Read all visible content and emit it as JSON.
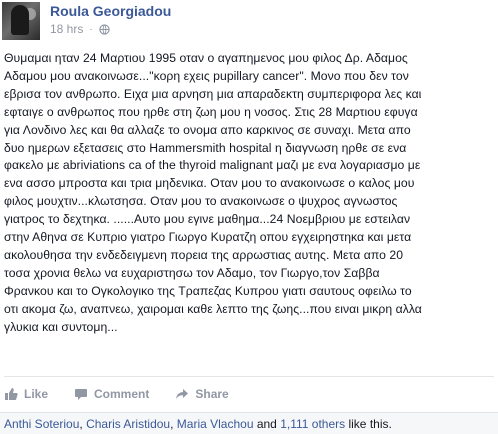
{
  "post": {
    "author": "Roula Georgiadou",
    "timestamp": "18 hrs",
    "separator": "·",
    "privacy_icon": "globe-icon",
    "body": "Θυμαμαι ηταν 24 Μαρτιου 1995 οταν ο αγαπημενος μου φιλος Δρ. Αδαμος\nΑδαμου μου ανακοινωσε...\"κορη εχεις pupillary cancer\". Μονο που δεν τον\nεβρισα τον ανθρωπο. Ειχα μια αρνηση μια απαραδεκτη συμπεριφορα λες και\nεφταιγε ο ανθρωπος που ηρθε στη ζωη μου η νοσος. Στις 28 Μαρτιου εφυγα\nγια Λονδινο λες και θα αλλαζε το ονομα απο καρκινος σε συναχι. Μετα απο\nδυο ημερων εξετασεις στο Hammersmith hospital η διαγνωση ηρθε σε ενα\nφακελο με abriviations ca of the thyroid malignant μαζι με ενα λογαριασμο με\nενα ασσο μπροστα και τρια μηδενικα. Οταν μου το ανακοινωσε ο καλος μου\nφιλος μουχτιν...κλωτσησα. Οταν μου το ανακοινωσε ο ψυχρος αγνωστος\nγιατρος το δεχτηκα. ......Αυτο μου εγινε μαθημα...24 Νοεμβριου με εστειλαν\nστην Αθηνα σε Κυπριο γιατρο Γιωργο Κυρατζη οπου εγχειρηστηκα και μετα\nακολουθησα την ενδεδειγμενη πορεια της αρρωστιας αυτης. Μετα απο 20\nτοσα χρονια θελω να ευχαριστησω τον Αδαμο, τον Γιωργο,τον Σαββα\nΦρανκου και το Ογκολογικο της Τραπεζας Κυπρου γιατι σαυτους οφειλω το\nοτι ακομα ζω, αναπνεω, χαιρομαι καθε λεπτο της ζωης...που ειναι μικρη αλλα\nγλυκια και συντομη..."
  },
  "actions": {
    "like": "Like",
    "comment": "Comment",
    "share": "Share"
  },
  "likes": {
    "name1": "Anthi Soteriou",
    "sep1": ", ",
    "name2": "Charis Aristidou",
    "sep2": ", ",
    "name3": "Maria Vlachou",
    "and": " and ",
    "others": "1,111 others",
    "suffix": " like this."
  },
  "colors": {
    "link": "#3b5998",
    "muted": "#9197a3",
    "text": "#141823"
  }
}
